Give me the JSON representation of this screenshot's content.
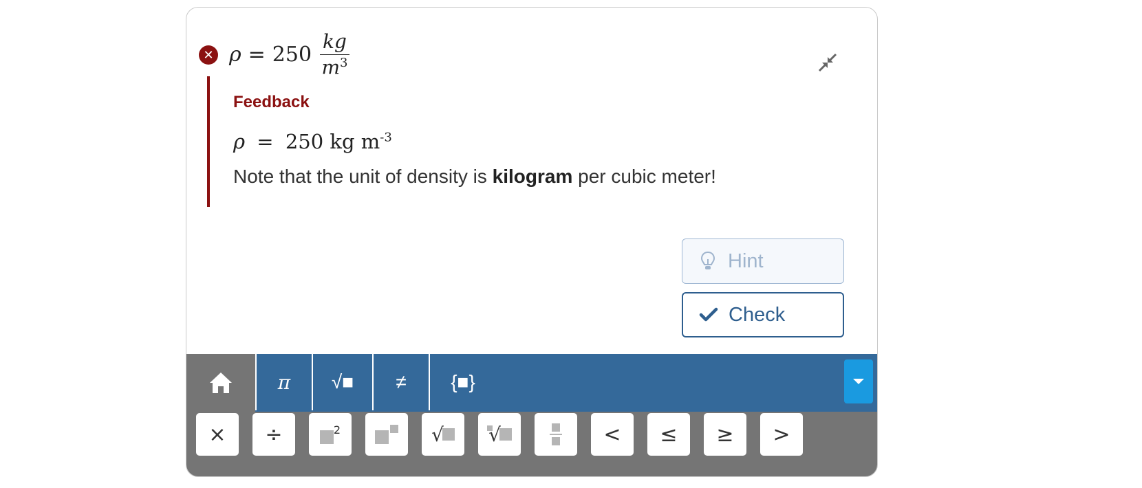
{
  "answer": {
    "status_icon": "error-x-icon",
    "variable": "ρ",
    "equals": "=",
    "value": "250",
    "unit_numerator": "kg",
    "unit_denominator_base": "m",
    "unit_denominator_exp": "3"
  },
  "feedback": {
    "title": "Feedback",
    "math_var": "ρ",
    "math_eq": "=",
    "math_value": "250 kg m",
    "math_exp": "-3",
    "note_before": "Note that the unit of density is ",
    "note_bold": "kilogram",
    "note_after": " per cubic meter!",
    "accent_color": "#8b1111"
  },
  "buttons": {
    "hint": "Hint",
    "check": "Check"
  },
  "toolbar": {
    "tabs": [
      {
        "label": "π",
        "icon": "pi-icon"
      },
      {
        "label": "√■",
        "icon": "sqrt-icon"
      },
      {
        "label": "≠",
        "icon": "not-equal-icon"
      },
      {
        "label": "{■}",
        "icon": "braces-icon"
      }
    ],
    "color": "#34699a"
  },
  "keypad": {
    "keys": [
      "×",
      "÷",
      "x²",
      "xⁿ",
      "√",
      "ⁿ√",
      "fraction",
      "<",
      "≤",
      "≥",
      ">"
    ],
    "lt": "<",
    "le": "≤",
    "ge": "≥",
    "gt": ">",
    "times": "×",
    "divide": "÷",
    "sq_exp": "2"
  }
}
